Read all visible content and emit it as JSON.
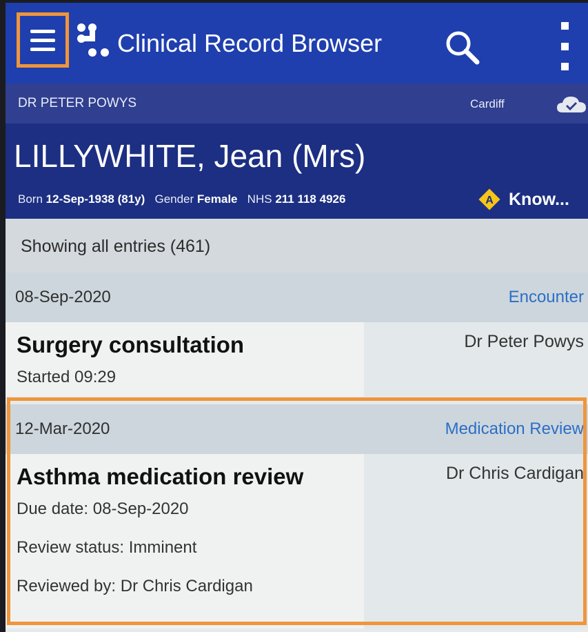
{
  "appbar": {
    "title": "Clinical Record Browser",
    "menu_icon": "hamburger-menu-icon",
    "logo_icon": "app-logo-icon",
    "search_icon": "search-icon",
    "more_icon": "more-vert-icon"
  },
  "practitioner": {
    "name": "DR PETER POWYS",
    "location": "Cardiff",
    "sync_icon": "cloud-check-icon"
  },
  "patient": {
    "name": "LILLYWHITE, Jean (Mrs)",
    "born_label": "Born",
    "born_value": "12-Sep-1938 (81y)",
    "gender_label": "Gender",
    "gender_value": "Female",
    "nhs_label": "NHS",
    "nhs_value": "211 118 4926",
    "alert_badge": "A",
    "alert_text": "Know..."
  },
  "filter": {
    "text": "Showing all entries (461)"
  },
  "entries": [
    {
      "date": "08-Sep-2020",
      "type": "Encounter",
      "title": "Surgery consultation",
      "clinician": "Dr Peter Powys",
      "lines": [
        "Started 09:29"
      ]
    },
    {
      "date": "12-Mar-2020",
      "type": "Medication Review",
      "title": "Asthma medication review",
      "clinician": "Dr Chris Cardigan",
      "lines": [
        "Due date: 08-Sep-2020",
        "Review status: Imminent",
        "Reviewed by: Dr Chris Cardigan"
      ]
    }
  ],
  "colors": {
    "appbar": "#1f3fae",
    "patient_bar": "#1c2f82",
    "link": "#2b6ec7",
    "highlight": "#f0953a",
    "alert": "#f5c518"
  }
}
